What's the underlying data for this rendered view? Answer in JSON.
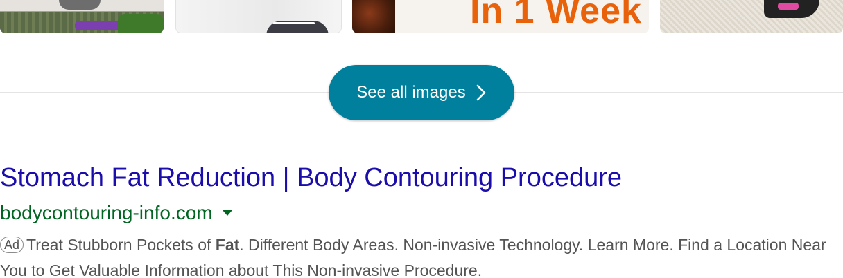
{
  "images_strip": {
    "thumb_3_overlay_text": "In 1 Week"
  },
  "see_all_button": {
    "label": "See all images",
    "icon": "chevron-right-icon",
    "color": "#00809d"
  },
  "ad_result": {
    "title": "Stomach Fat Reduction | Body Contouring Procedure",
    "url": "bodycontouring-info.com",
    "url_menu_icon": "caret-down-icon",
    "ad_badge": "Ad",
    "snippet_before": "Treat Stubborn Pockets of ",
    "snippet_bold": "Fat",
    "snippet_after": ". Different Body Areas. Non-invasive Technology. Learn More. Find a Location Near You to Get Valuable Information about This Non-invasive Procedure.",
    "colors": {
      "title": "#1a0dab",
      "url": "#006621",
      "snippet": "#545454"
    }
  }
}
